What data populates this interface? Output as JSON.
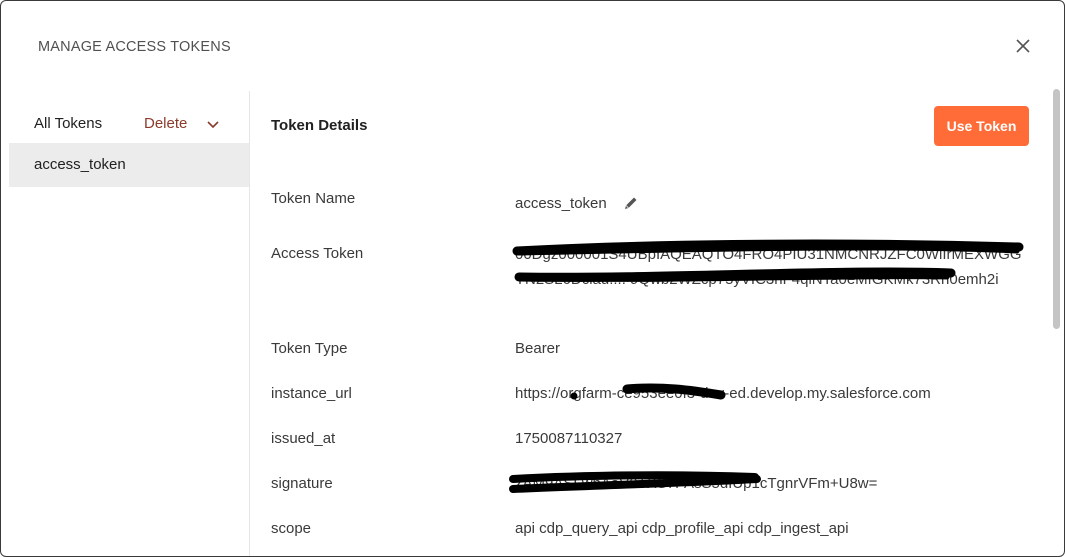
{
  "modal": {
    "title": "MANAGE ACCESS TOKENS"
  },
  "sidebar": {
    "header": "All Tokens",
    "delete_label": "Delete",
    "items": [
      {
        "label": "access_token"
      }
    ]
  },
  "details": {
    "title": "Token Details",
    "use_token_label": "Use Token",
    "fields": [
      {
        "label": "Token Name",
        "value": "access_token"
      },
      {
        "label": "Access Token",
        "value": "00Dgz000001S4UBpIAQEAQTO4FRO4PIU31NMCNRJZFC0WlIrMEXWGGYN2SL6Dciau.... 9Qwb2WZcp75yVIC3hF4qiNTa0eMfGKMk73Rh0emh2i"
      },
      {
        "label": "Token Type",
        "value": "Bearer"
      },
      {
        "label": "instance_url",
        "value": "https://orgfarm-ce953ee0f3-dev-ed.develop.my.salesforce.com"
      },
      {
        "label": "issued_at",
        "value": "1750087110327"
      },
      {
        "label": "signature",
        "value": "zAM9ASLwhAaV0TXS7PAsS5dIUp1cTgnrVFm+U8w="
      },
      {
        "label": "scope",
        "value": "api cdp_query_api cdp_profile_api cdp_ingest_api"
      }
    ]
  },
  "colors": {
    "accent": "#ff6c37",
    "delete": "#8b3a2b",
    "selected_row": "#ececec",
    "redaction": "#000000"
  },
  "icons": {
    "close": "close-icon",
    "chevron": "chevron-down-icon",
    "edit": "pencil-icon"
  }
}
